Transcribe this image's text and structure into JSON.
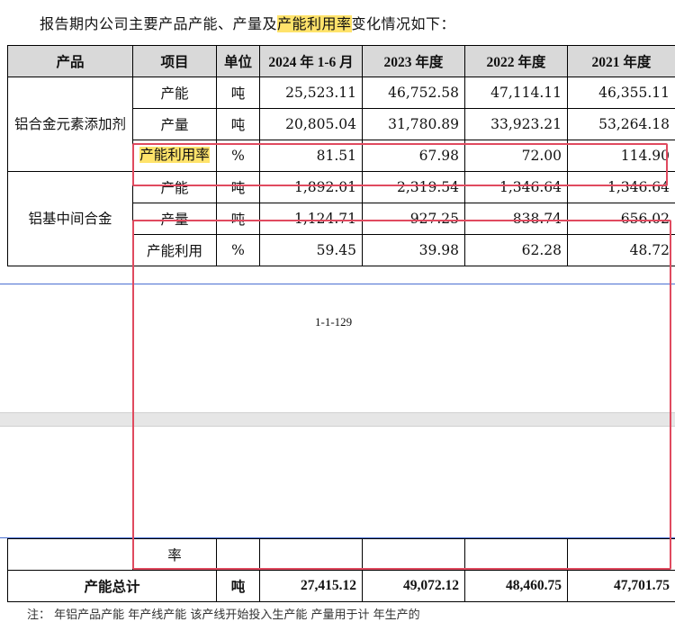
{
  "intro": {
    "before": "报告期内公司主要产品产能、产量及",
    "highlight": "产能利用率",
    "after": "变化情况如下："
  },
  "table": {
    "headers": [
      "产品",
      "项目",
      "单位",
      "2024 年 1-6 月",
      "2023 年度",
      "2022 年度",
      "2021 年度"
    ],
    "groups": [
      {
        "product": "铝合金元素添加剂",
        "rows": [
          {
            "item": "产能",
            "unit": "吨",
            "values": [
              "25,523.11",
              "46,752.58",
              "47,114.11",
              "46,355.11"
            ]
          },
          {
            "item": "产量",
            "unit": "吨",
            "values": [
              "20,805.04",
              "31,780.89",
              "33,923.21",
              "53,264.18"
            ]
          },
          {
            "item": "产能利用率",
            "unit": "%",
            "values": [
              "81.51",
              "67.98",
              "72.00",
              "114.90"
            ]
          }
        ]
      },
      {
        "product": "铝基中间合金",
        "rows": [
          {
            "item": "产能",
            "unit": "吨",
            "values": [
              "1,892.01",
              "2,319.54",
              "1,346.64",
              "1,346.64"
            ]
          },
          {
            "item": "产量",
            "unit": "吨",
            "values": [
              "1,124.71",
              "927.25",
              "838.74",
              "656.02"
            ]
          },
          {
            "item": "产能利用",
            "unit": "%",
            "values": [
              "59.45",
              "39.98",
              "62.28",
              "48.72"
            ]
          }
        ]
      }
    ],
    "continued_item": "率",
    "total": {
      "label": "产能总计",
      "unit": "吨",
      "values": [
        "27,415.12",
        "49,072.12",
        "48,460.75",
        "47,701.75"
      ]
    }
  },
  "page_number": "1-1-129",
  "footer_fragment": "注：    年铝产品产能    年产线产能    该产线开始投入生产能    产量用于计    年生产的"
}
